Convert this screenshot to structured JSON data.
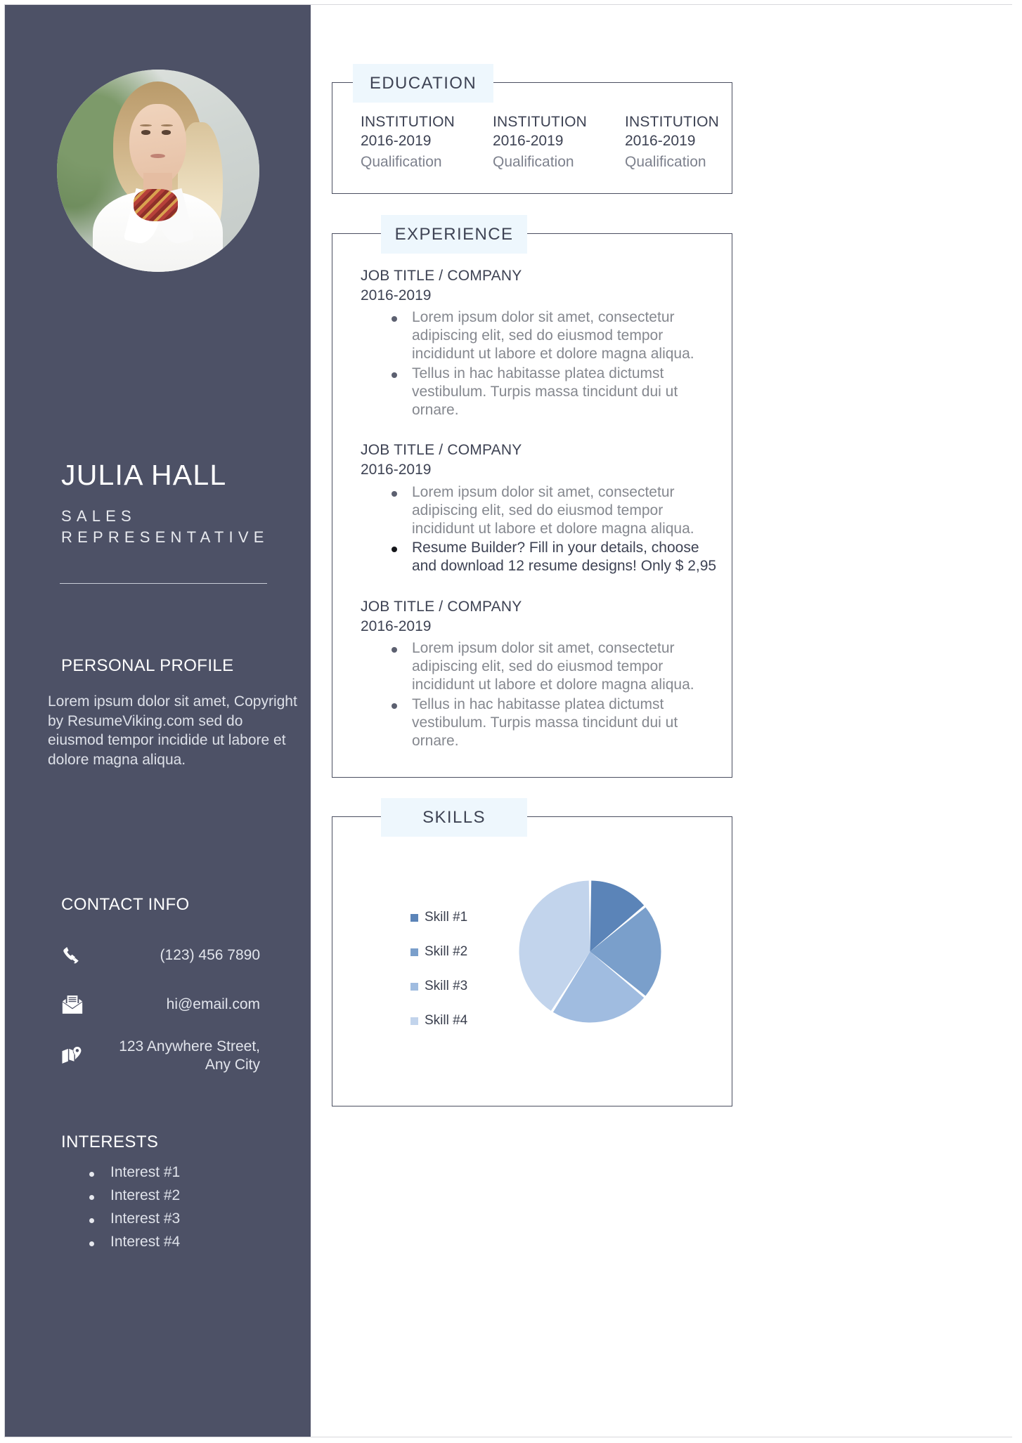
{
  "colors": {
    "sidebar_bg": "#4d5166",
    "section_title_bg": "#eef7fd",
    "border": "#4a4e60",
    "body_text": "#85888f",
    "heading_text": "#3d4253"
  },
  "sidebar": {
    "name": "JULIA HALL",
    "role": "SALES REPRESENTATIVE",
    "personal_profile": {
      "heading": "PERSONAL PROFILE",
      "text": "Lorem ipsum dolor sit amet, Copyright by ResumeViking.com sed do eiusmod tempor incidide ut labore et dolore magna aliqua."
    },
    "contact": {
      "heading": "CONTACT INFO",
      "items": [
        {
          "icon": "phone-icon",
          "value": "(123) 456 7890"
        },
        {
          "icon": "email-icon",
          "value": "hi@email.com"
        },
        {
          "icon": "map-icon",
          "value": "123 Anywhere Street, Any City"
        }
      ]
    },
    "interests": {
      "heading": "INTERESTS",
      "items": [
        "Interest #1",
        "Interest #2",
        "Interest #3",
        "Interest #4"
      ]
    }
  },
  "education": {
    "title": "EDUCATION",
    "items": [
      {
        "institution": "INSTITUTION",
        "years": "2016-2019",
        "qualification": "Qualification"
      },
      {
        "institution": "INSTITUTION",
        "years": "2016-2019",
        "qualification": "Qualification"
      },
      {
        "institution": "INSTITUTION",
        "years": "2016-2019",
        "qualification": "Qualification"
      }
    ]
  },
  "experience": {
    "title": "EXPERIENCE",
    "jobs": [
      {
        "title": "JOB TITLE / COMPANY",
        "years": "2016-2019",
        "bullets": [
          {
            "text": "Lorem ipsum dolor sit amet, consectetur adipiscing elit, sed do eiusmod tempor incididunt ut labore et dolore magna aliqua.",
            "highlight": false
          },
          {
            "text": "Tellus in hac habitasse platea dictumst vestibulum. Turpis massa tincidunt dui ut ornare.",
            "highlight": false
          }
        ]
      },
      {
        "title": "JOB TITLE / COMPANY",
        "years": "2016-2019",
        "bullets": [
          {
            "text": "Lorem ipsum dolor sit amet, consectetur adipiscing elit, sed do eiusmod tempor incididunt ut labore et dolore magna aliqua.",
            "highlight": false
          },
          {
            "text": "Resume Builder? Fill in your details, choose and download 12 resume designs! Only $ 2,95",
            "highlight": true
          }
        ]
      },
      {
        "title": "JOB TITLE / COMPANY",
        "years": "2016-2019",
        "bullets": [
          {
            "text": "Lorem ipsum dolor sit amet, consectetur adipiscing elit, sed do eiusmod tempor incididunt ut labore et dolore magna aliqua.",
            "highlight": false
          },
          {
            "text": "Tellus in hac habitasse platea dictumst vestibulum. Turpis massa tincidunt dui ut ornare.",
            "highlight": false
          }
        ]
      }
    ]
  },
  "skills": {
    "title": "SKILLS"
  },
  "chart_data": {
    "type": "pie",
    "title": "SKILLS",
    "categories": [
      "Skill #1",
      "Skill #2",
      "Skill #3",
      "Skill #4"
    ],
    "values": [
      14,
      22,
      23,
      41
    ],
    "colors": [
      "#5b84b8",
      "#7a9fcb",
      "#a0bce0",
      "#c2d4ec"
    ],
    "legend_position": "left",
    "start_angle_deg": 0,
    "gap_deg": 2,
    "labels_shown": false
  }
}
